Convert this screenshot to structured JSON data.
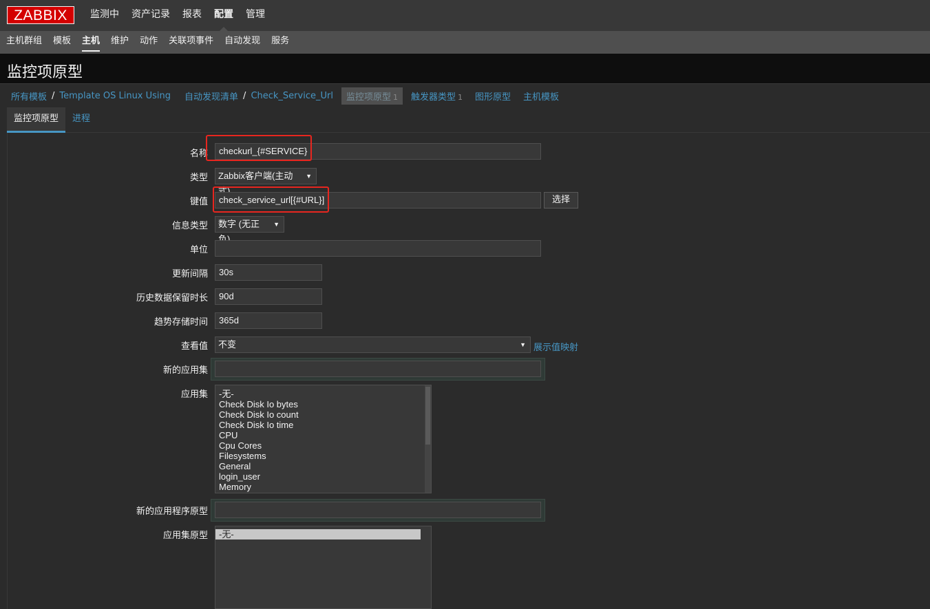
{
  "logo": "ZABBIX",
  "top_nav": [
    "监测中",
    "资产记录",
    "报表",
    "配置",
    "管理"
  ],
  "top_nav_active": 3,
  "sub_nav": [
    "主机群组",
    "模板",
    "主机",
    "维护",
    "动作",
    "关联项事件",
    "自动发现",
    "服务"
  ],
  "sub_nav_active": 2,
  "page_title": "监控项原型",
  "breadcrumbs": {
    "all_templates": "所有模板",
    "template": "Template OS Linux Using",
    "discovery_list": "自动发现清单",
    "rule": "Check_Service_Url",
    "item_prototypes": "监控项原型",
    "item_prototypes_count": "1",
    "trigger_prototypes": "触发器类型",
    "trigger_prototypes_count": "1",
    "graph_prototypes": "图形原型",
    "host_prototypes": "主机模板",
    "sep": "/"
  },
  "tabs": {
    "active": "监控项原型",
    "other": "进程"
  },
  "form": {
    "name_label": "名称",
    "name_value": "checkurl_{#SERVICE}",
    "type_label": "类型",
    "type_value": "Zabbix客户端(主动式)",
    "key_label": "键值",
    "key_value": "check_service_url[{#URL}]",
    "select_button": "选择",
    "info_type_label": "信息类型",
    "info_type_value": "数字 (无正负)",
    "units_label": "单位",
    "units_value": "",
    "interval_label": "更新间隔",
    "interval_value": "30s",
    "history_label": "历史数据保留时长",
    "history_value": "90d",
    "trends_label": "趋势存储时间",
    "trends_value": "365d",
    "show_value_label": "查看值",
    "show_value_value": "不变",
    "show_value_link": "展示值映射",
    "new_app_label": "新的应用集",
    "new_app_value": "",
    "apps_label": "应用集",
    "apps_options": [
      "-无-",
      "Check Disk Io bytes",
      "Check Disk Io count",
      "Check Disk Io time",
      "CPU",
      "Cpu Cores",
      "Filesystems",
      "General",
      "login_user",
      "Memory"
    ],
    "new_app_proto_label": "新的应用程序原型",
    "new_app_proto_value": "",
    "app_proto_label": "应用集原型",
    "app_proto_options": [
      "-无-"
    ]
  },
  "colors": {
    "accent_link": "#4796c4",
    "highlight_box": "#e8261f",
    "logo_bg": "#d40000"
  }
}
